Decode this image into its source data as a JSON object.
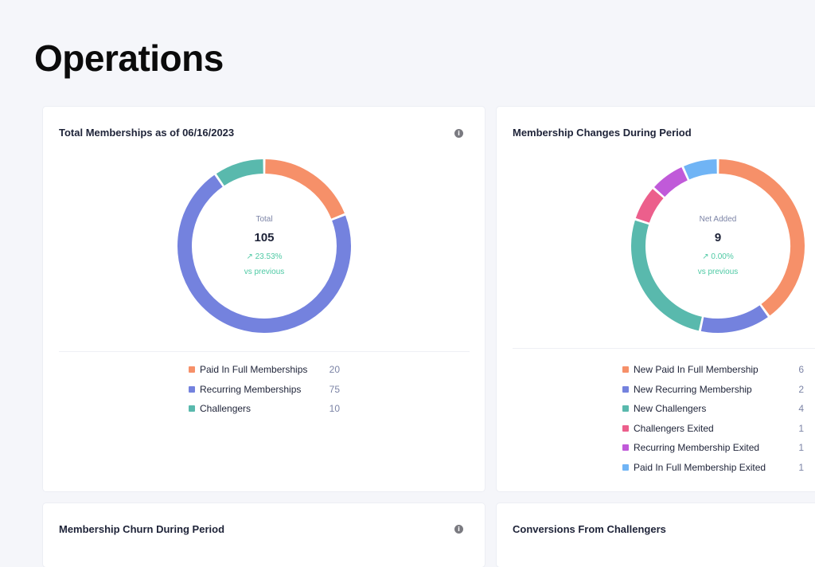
{
  "page": {
    "title": "Operations"
  },
  "cards": {
    "total": {
      "title": "Total Memberships as of 06/16/2023",
      "info_icon": "info-icon",
      "center": {
        "label": "Total",
        "value": "105",
        "change": "↗ 23.53%",
        "vs": "vs previous"
      },
      "legend": [
        {
          "label": "Paid In Full Memberships",
          "value": "20",
          "color": "#f69069"
        },
        {
          "label": "Recurring Memberships",
          "value": "75",
          "color": "#7482de"
        },
        {
          "label": "Challengers",
          "value": "10",
          "color": "#59b9ad"
        }
      ]
    },
    "changes": {
      "title": "Membership Changes During Period",
      "center": {
        "label": "Net Added",
        "value": "9",
        "change": "↗ 0.00%",
        "vs": "vs previous"
      },
      "legend": [
        {
          "label": "New Paid In Full Membership",
          "value": "6",
          "color": "#f69069"
        },
        {
          "label": "New Recurring Membership",
          "value": "2",
          "color": "#7482de"
        },
        {
          "label": "New Challengers",
          "value": "4",
          "color": "#59b9ad"
        },
        {
          "label": "Challengers Exited",
          "value": "1",
          "color": "#ec5f8c"
        },
        {
          "label": "Recurring Membership Exited",
          "value": "1",
          "color": "#c05ad9"
        },
        {
          "label": "Paid In Full Membership Exited",
          "value": "1",
          "color": "#70b4f5"
        }
      ]
    },
    "churn": {
      "title": "Membership Churn During Period",
      "info_icon": "info-icon"
    },
    "conversions": {
      "title": "Conversions From Challengers"
    }
  },
  "chart_data": [
    {
      "type": "pie",
      "title": "Total Memberships as of 06/16/2023",
      "categories": [
        "Paid In Full Memberships",
        "Recurring Memberships",
        "Challengers"
      ],
      "values": [
        20,
        75,
        10
      ],
      "colors": [
        "#f69069",
        "#7482de",
        "#59b9ad"
      ],
      "donut": true,
      "center_text": {
        "label": "Total",
        "value": 105,
        "change_pct": 23.53
      }
    },
    {
      "type": "pie",
      "title": "Membership Changes During Period",
      "categories": [
        "New Paid In Full Membership",
        "New Recurring Membership",
        "New Challengers",
        "Challengers Exited",
        "Recurring Membership Exited",
        "Paid In Full Membership Exited"
      ],
      "values": [
        6,
        2,
        4,
        1,
        1,
        1
      ],
      "colors": [
        "#f69069",
        "#7482de",
        "#59b9ad",
        "#ec5f8c",
        "#c05ad9",
        "#70b4f5"
      ],
      "donut": true,
      "center_text": {
        "label": "Net Added",
        "value": 9,
        "change_pct": 0.0
      }
    }
  ]
}
